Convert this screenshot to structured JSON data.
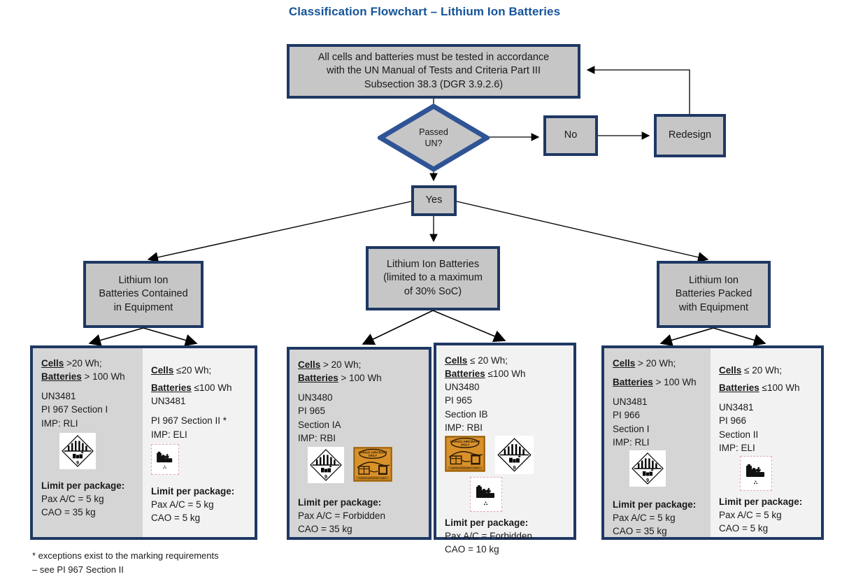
{
  "title": "Classification Flowchart – Lithium Ion Batteries",
  "nodes": {
    "top_box": "All cells and batteries must be tested in accordance with the UN Manual of Tests and Criteria Part III Subsection 38.3 (DGR 3.9.2.6)",
    "top_box_line1": "All cells and batteries must be tested in accordance",
    "top_box_line2": "with the UN Manual of Tests and Criteria Part III",
    "top_box_line3": "Subsection 38.3 (DGR 3.9.2.6)",
    "decision_line1": "Passed",
    "decision_line2": "UN?",
    "no": "No",
    "redesign": "Redesign",
    "yes": "Yes",
    "cat_left_line1": "Lithium Ion",
    "cat_left_line2": "Batteries Contained",
    "cat_left_line3": "in Equipment",
    "cat_mid_line1": "Lithium Ion Batteries",
    "cat_mid_line2": "(limited to a maximum",
    "cat_mid_line3": "of 30% SoC)",
    "cat_right_line1": "Lithium Ion",
    "cat_right_line2": "Batteries Packed",
    "cat_right_line3": "with Equipment"
  },
  "panels": {
    "left_a": {
      "cells_label": "Cells",
      "cells_value": " >20 Wh;",
      "batteries_label": "Batteries",
      "batteries_value": " > 100 Wh",
      "un": "UN3481",
      "pi": "PI 967 Section I",
      "imp": "IMP: RLI",
      "limit_heading": "Limit per package:",
      "pax": "Pax A/C = 5 kg",
      "cao": "CAO = 35 kg"
    },
    "left_b": {
      "cells_label": "Cells",
      "cells_value": " ≤20 Wh;",
      "batteries_label": "Batteries",
      "batteries_value": " ≤100 Wh",
      "un": "UN3481",
      "pi": "PI 967 Section II *",
      "imp": "IMP: ELI",
      "limit_heading": "Limit per package:",
      "pax": "Pax A/C = 5 kg",
      "cao": "CAO = 5 kg"
    },
    "mid_a": {
      "cells_label": "Cells",
      "cells_value": " > 20 Wh;",
      "batteries_label": "Batteries",
      "batteries_value": " > 100 Wh",
      "un": "UN3480",
      "pi": "PI 965",
      "section": "Section IA",
      "imp": "IMP: RBI",
      "limit_heading": "Limit per package:",
      "pax": "Pax A/C = Forbidden",
      "cao": "CAO = 35 kg"
    },
    "mid_b": {
      "cells_label": "Cells",
      "cells_value": " ≤ 20 Wh;",
      "batteries_label": "Batteries",
      "batteries_value": " ≤100 Wh",
      "un": "UN3480",
      "pi": "PI 965",
      "section": "Section IB",
      "imp": "IMP: RBI",
      "limit_heading": "Limit per package:",
      "pax": "Pax A/C = Forbidden",
      "cao": "CAO = 10 kg"
    },
    "right_a": {
      "cells_label": "Cells",
      "cells_value": " > 20 Wh;",
      "batteries_label": "Batteries",
      "batteries_value": " > 100 Wh",
      "un": "UN3481",
      "pi": "PI 966",
      "section": "Section I",
      "imp": "IMP: RLI",
      "limit_heading": "Limit per package:",
      "pax": "Pax A/C =  5 kg",
      "cao": "CAO = 35 kg"
    },
    "right_b": {
      "cells_label": "Cells",
      "cells_value": " ≤ 20 Wh;",
      "batteries_label": "Batteries",
      "batteries_value": " ≤100 Wh",
      "un": "UN3481",
      "pi": "PI 966",
      "section": "Section II",
      "imp": "IMP: ELI",
      "limit_heading": "Limit per package:",
      "pax": "Pax A/C = 5 kg",
      "cao": "CAO = 5 kg"
    }
  },
  "footnote_line1": "* exceptions exist to the marking requirements",
  "footnote_line2": "– see PI 967 Section II",
  "icons": {
    "class9": "class-9-lithium-battery-hazard-label",
    "cao": "cargo-aircraft-only-label",
    "lithium_mark": "lithium-battery-mark"
  },
  "colors": {
    "title": "#155499",
    "border": "#1f3864",
    "fill_grey": "#c6c6c6",
    "fill_panel_grey": "#d5d5d5",
    "fill_panel_light": "#f2f2f2",
    "cao_orange": "#d9912a"
  }
}
